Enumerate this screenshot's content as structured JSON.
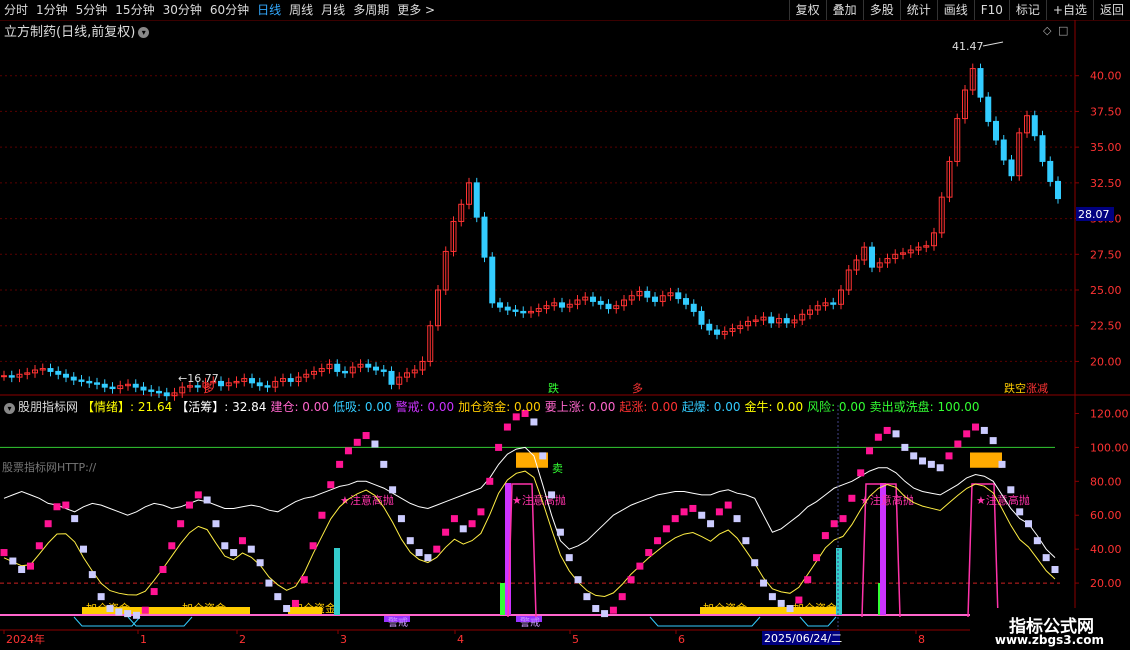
{
  "toolbar": {
    "periods": [
      "分时",
      "1分钟",
      "5分钟",
      "15分钟",
      "30分钟",
      "60分钟",
      "日线",
      "周线",
      "月线",
      "多周期",
      "更多 >"
    ],
    "active_period": "日线",
    "right_buttons": [
      "复权",
      "叠加",
      "多股",
      "统计",
      "画线",
      "F10",
      "标记",
      "+自选",
      "返回"
    ]
  },
  "stock_title": "立方制药(日线,前复权)",
  "chart_data": [
    {
      "type": "candlestick",
      "title": "立方制药(日线,前复权)",
      "y_ticks": [
        "40.00",
        "37.50",
        "35.00",
        "32.50",
        "30.00",
        "27.50",
        "25.00",
        "22.50",
        "20.00"
      ],
      "ylim": [
        18.0,
        42.5
      ],
      "current_price": "28.07",
      "high_label": "41.47",
      "low_label": "16.77",
      "annotations": [
        "跌",
        "多",
        "多",
        "跌",
        "空",
        "跌",
        "涨",
        "减"
      ],
      "closes": [
        19.0,
        18.9,
        19.1,
        19.2,
        19.4,
        19.5,
        19.3,
        19.1,
        18.9,
        18.7,
        18.6,
        18.5,
        18.4,
        18.2,
        18.1,
        18.3,
        18.4,
        18.2,
        18.0,
        17.9,
        17.8,
        17.6,
        17.8,
        18.2,
        18.3,
        18.2,
        18.5,
        18.6,
        18.3,
        18.5,
        18.6,
        18.8,
        18.5,
        18.3,
        18.2,
        18.6,
        18.8,
        18.6,
        18.9,
        19.1,
        19.3,
        19.5,
        19.8,
        19.3,
        19.2,
        19.6,
        19.8,
        19.6,
        19.4,
        19.3,
        18.4,
        18.9,
        19.2,
        19.4,
        20.0,
        22.5,
        25.0,
        27.7,
        29.8,
        31.0,
        32.5,
        30.1,
        27.3,
        24.1,
        23.8,
        23.6,
        23.5,
        23.4,
        23.5,
        23.7,
        23.9,
        24.1,
        23.8,
        24.0,
        24.3,
        24.5,
        24.2,
        24.0,
        23.7,
        23.9,
        24.3,
        24.6,
        24.9,
        24.5,
        24.2,
        24.6,
        24.8,
        24.4,
        24.0,
        23.5,
        22.6,
        22.2,
        21.9,
        22.1,
        22.3,
        22.5,
        22.8,
        22.9,
        23.1,
        22.7,
        23.0,
        22.7,
        22.9,
        23.3,
        23.6,
        23.9,
        24.1,
        24.0,
        25.0,
        26.4,
        27.1,
        28.0,
        26.6,
        26.9,
        27.2,
        27.5,
        27.6,
        27.8,
        28.0,
        28.1,
        29.0,
        31.5,
        34.0,
        37.0,
        39.0,
        40.5,
        38.5,
        36.8,
        35.5,
        34.1,
        33.0,
        36.0,
        37.2,
        35.8,
        34.0,
        32.6,
        31.4
      ]
    },
    {
      "type": "line",
      "title": "股朋指标网",
      "y_ticks": [
        "120.00",
        "100.00",
        "80.00",
        "60.00",
        "40.00",
        "20.00"
      ],
      "ylim": [
        0,
        125
      ],
      "x_ticks": [
        "2024年",
        "1",
        "2",
        "3",
        "4",
        "5",
        "6",
        "7",
        "8"
      ],
      "cursor_date": "2025/06/24/二",
      "labels": {
        "jiacang": "加仓资金",
        "gaopao": "★注意高抛",
        "jingjie": "警戒",
        "mai": "卖"
      },
      "series": [
        {
          "name": "情绪",
          "values": [
            38,
            33,
            28,
            30,
            42,
            55,
            65,
            66,
            58,
            40,
            25,
            12,
            5,
            3,
            2,
            1,
            4,
            15,
            28,
            42,
            55,
            66,
            72,
            69,
            55,
            42,
            38,
            45,
            40,
            32,
            20,
            12,
            5,
            8,
            22,
            42,
            60,
            78,
            90,
            98,
            103,
            107,
            102,
            90,
            75,
            58,
            45,
            38,
            35,
            40,
            50,
            58,
            52,
            55,
            62,
            80,
            100,
            112,
            118,
            120,
            115,
            95,
            72,
            50,
            35,
            22,
            12,
            5,
            2,
            4,
            12,
            22,
            30,
            38,
            45,
            52,
            58,
            62,
            64,
            60,
            55,
            62,
            66,
            58,
            45,
            32,
            20,
            12,
            8,
            5,
            10,
            22,
            35,
            48,
            55,
            58,
            70,
            85,
            98,
            106,
            110,
            108,
            100,
            95,
            92,
            90,
            88,
            95,
            102,
            108,
            112,
            110,
            104,
            90,
            75,
            62,
            55,
            45,
            35,
            28
          ]
        },
        {
          "name": "活筹",
          "values": [
            70,
            72,
            74,
            72,
            70,
            67,
            66,
            64,
            62,
            65,
            67,
            66,
            64,
            62,
            60,
            62,
            65,
            67,
            66,
            64,
            65,
            67,
            69,
            68,
            66,
            64,
            64,
            65,
            66,
            65,
            63,
            62,
            65,
            68,
            70,
            71,
            73,
            75,
            77,
            78,
            80,
            80,
            78,
            76,
            73,
            70,
            67,
            65,
            64,
            66,
            68,
            70,
            72,
            74,
            76,
            82,
            90,
            96,
            99,
            100,
            95,
            78,
            60,
            45,
            40,
            42,
            45,
            50,
            55,
            60,
            63,
            66,
            68,
            70,
            72,
            73,
            74,
            74,
            73,
            72,
            72,
            74,
            75,
            73,
            72,
            70,
            60,
            50,
            52,
            56,
            60,
            65,
            68,
            72,
            76,
            78,
            80,
            83,
            86,
            88,
            88,
            85,
            80,
            76,
            74,
            73,
            72,
            75,
            78,
            82,
            84,
            83,
            80,
            72,
            64,
            58,
            55,
            48,
            40,
            35
          ]
        }
      ]
    }
  ],
  "lower_header": {
    "name": "股朋指标网",
    "items": [
      {
        "label": "【情绪】:",
        "value": "21.64",
        "color": "#ffff00"
      },
      {
        "label": "【活筹】:",
        "value": "32.84",
        "color": "#ffffff"
      },
      {
        "label": "建仓:",
        "value": "0.00",
        "color": "#ff66cc"
      },
      {
        "label": "低吸:",
        "value": "0.00",
        "color": "#33ccff"
      },
      {
        "label": "警戒:",
        "value": "0.00",
        "color": "#cc33ff"
      },
      {
        "label": "加仓资金:",
        "value": "0.00",
        "color": "#ffcc00"
      },
      {
        "label": "要上涨:",
        "value": "0.00",
        "color": "#ff66cc"
      },
      {
        "label": "起涨:",
        "value": "0.00",
        "color": "#ff3333"
      },
      {
        "label": "起爆:",
        "value": "0.00",
        "color": "#33ccff"
      },
      {
        "label": "金牛:",
        "value": "0.00",
        "color": "#ffff00"
      },
      {
        "label": "风险:",
        "value": "0.00",
        "color": "#33ff33"
      },
      {
        "label": "卖出或洗盘:",
        "value": "100.00",
        "color": "#33ff33"
      }
    ]
  },
  "watermark_text": "股票指标网HTTP://",
  "logo": {
    "title": "指标公式网",
    "url": "www.zbgs3.com"
  }
}
